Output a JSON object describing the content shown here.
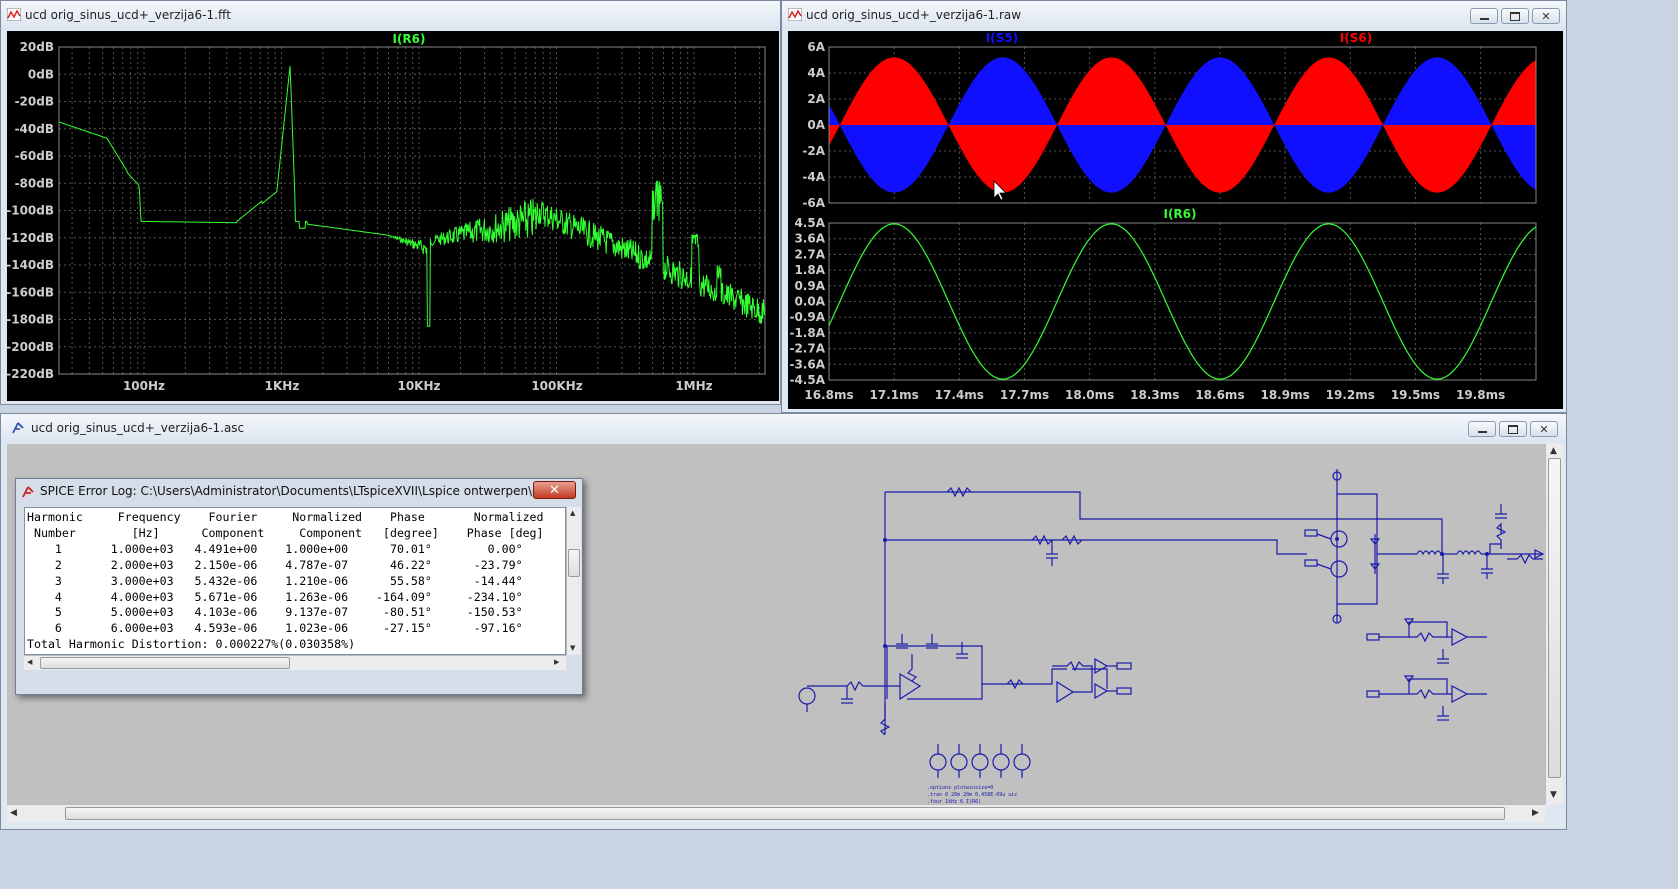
{
  "fft_window": {
    "title": "ucd orig_sinus_ucd+_verzija6-1.fft",
    "trace_label": "I(R6)",
    "y_ticks": [
      "20dB",
      "0dB",
      "-20dB",
      "-40dB",
      "-60dB",
      "-80dB",
      "-100dB",
      "-120dB",
      "-140dB",
      "-160dB",
      "-180dB",
      "-200dB",
      "-220dB"
    ],
    "x_ticks": [
      "100Hz",
      "1KHz",
      "10KHz",
      "100KHz",
      "1MHz"
    ],
    "trace_color": "#33ff33"
  },
  "raw_window": {
    "title": "ucd orig_sinus_ucd+_verzija6-1.raw",
    "top_pane": {
      "labels": [
        "I(S5)",
        "I(S6)"
      ],
      "colors": [
        "#1010ff",
        "#ff0000"
      ],
      "y_ticks": [
        "6A",
        "4A",
        "2A",
        "0A",
        "-2A",
        "-4A",
        "-6A"
      ]
    },
    "bottom_pane": {
      "label": "I(R6)",
      "color": "#33ff33",
      "y_ticks": [
        "4.5A",
        "3.6A",
        "2.7A",
        "1.8A",
        "0.9A",
        "0.0A",
        "-0.9A",
        "-1.8A",
        "-2.7A",
        "-3.6A",
        "-4.5A"
      ]
    },
    "x_ticks": [
      "16.8ms",
      "17.1ms",
      "17.4ms",
      "17.7ms",
      "18.0ms",
      "18.3ms",
      "18.6ms",
      "18.9ms",
      "19.2ms",
      "19.5ms",
      "19.8ms"
    ]
  },
  "schematic_window": {
    "title": "ucd orig_sinus_ucd+_verzija6-1.asc"
  },
  "error_log": {
    "title": "SPICE Error Log: C:\\Users\\Administrator\\Documents\\LTspiceXVII\\Lspice ontwerpen\\goede amps\\i...",
    "close_label": "✕",
    "lines": [
      "Harmonic     Frequency    Fourier     Normalized    Phase       Normalized",
      " Number        [Hz]      Component     Component   [degree]    Phase [deg]",
      "    1       1.000e+03   4.491e+00    1.000e+00      70.01°        0.00°",
      "    2       2.000e+03   2.150e-06    4.787e-07      46.22°      -23.79°",
      "    3       3.000e+03   5.432e-06    1.210e-06      55.58°      -14.44°",
      "    4       4.000e+03   5.671e-06    1.263e-06    -164.09°     -234.10°",
      "    5       5.000e+03   4.103e-06    9.137e-07     -80.51°     -150.53°",
      "    6       6.000e+03   4.593e-06    1.023e-06     -27.15°      -97.16°",
      "Total Harmonic Distortion: 0.000227%(0.030358%)"
    ]
  }
}
